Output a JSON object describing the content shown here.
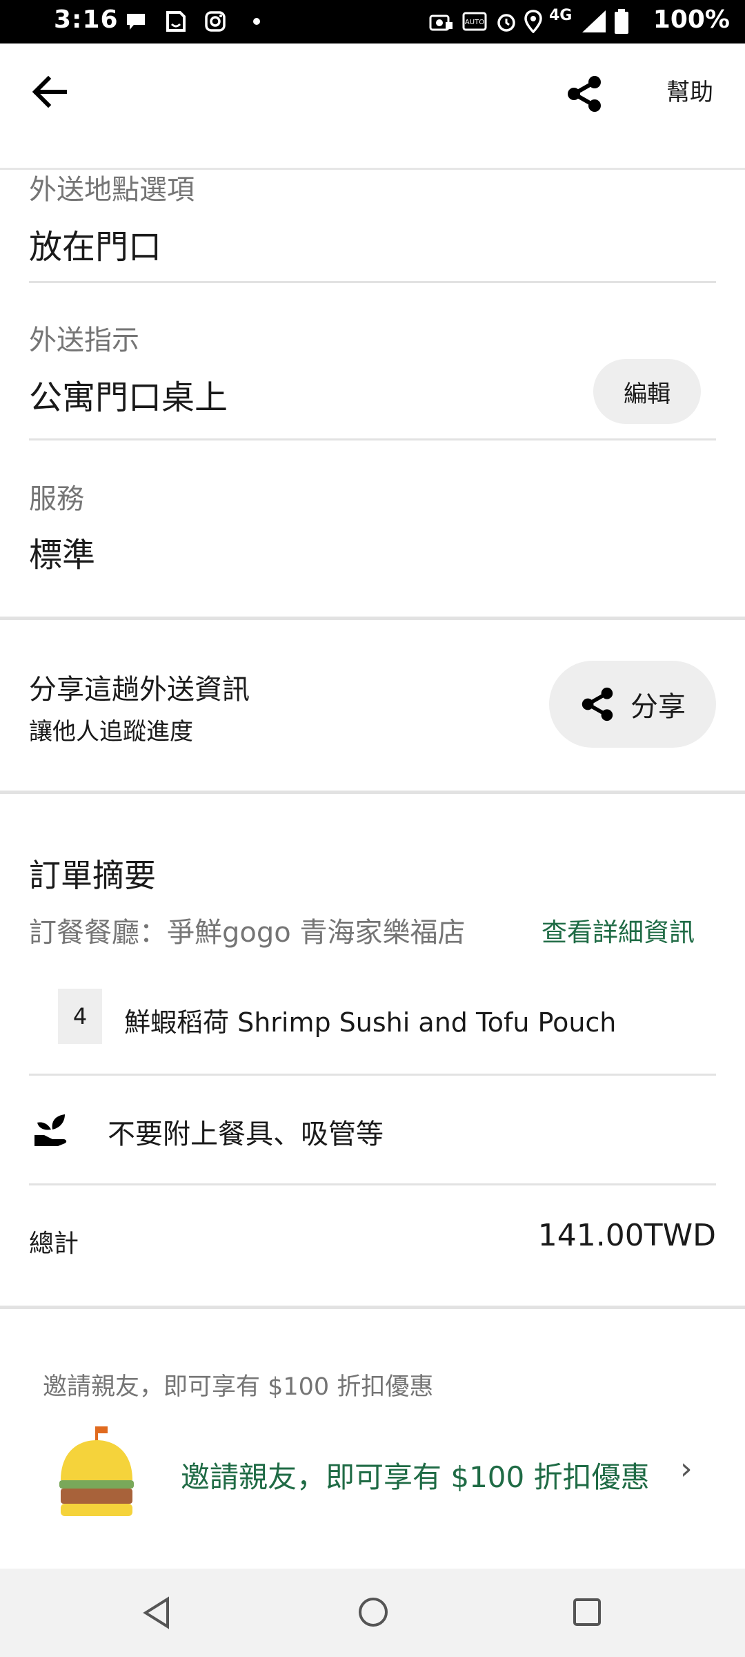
{
  "status_bar": {
    "time": "3:16",
    "battery": "100%",
    "network": "4G"
  },
  "header": {
    "help": "幫助"
  },
  "delivery_option": {
    "label": "外送地點選項",
    "value": "放在門口"
  },
  "instructions": {
    "label": "外送指示",
    "value": "公寓門口桌上",
    "edit": "編輯"
  },
  "service": {
    "label": "服務",
    "value": "標準"
  },
  "share": {
    "title": "分享這趟外送資訊",
    "subtitle": "讓他人追蹤進度",
    "button": "分享"
  },
  "order": {
    "heading": "訂單摘要",
    "restaurant": "訂餐餐廳：爭鮮gogo 青海家樂福店",
    "details_link": "查看詳細資訊",
    "item": {
      "qty": "4",
      "name": "鮮蝦稻荷 Shrimp Sushi and Tofu Pouch"
    },
    "no_utensils": "不要附上餐具、吸管等",
    "total_label": "總計",
    "total_value": "141.00TWD"
  },
  "invite": {
    "caption": "邀請親友，即可享有 $100 折扣優惠",
    "link": "邀請親友，即可享有 $100 折扣優惠"
  },
  "colors": {
    "accent_green": "#1f6b45",
    "grey_text": "#757575",
    "pill_bg": "#eeeeee"
  }
}
